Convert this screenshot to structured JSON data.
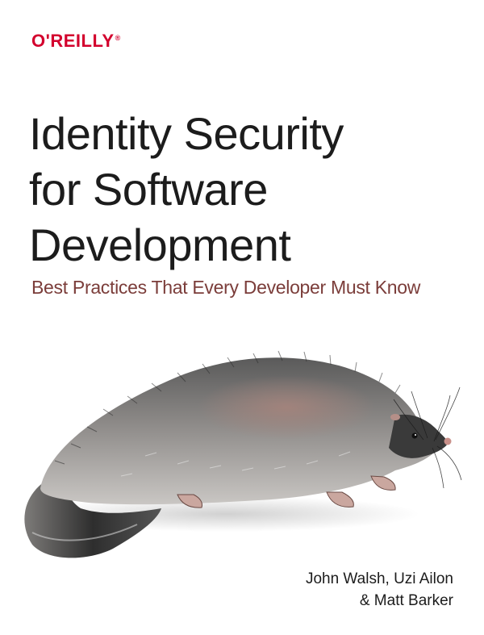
{
  "publisher": {
    "name": "O'REILLY",
    "registered_mark": "®"
  },
  "title": {
    "lines": [
      "Identity Security",
      "for Software",
      "Development"
    ]
  },
  "subtitle": "Best Practices That Every Developer Must Know",
  "authors": {
    "line1": "John Walsh, Uzi Ailon",
    "line2": "& Matt Barker"
  },
  "illustration": {
    "icon": "hedgehog-illustration-icon"
  },
  "colors": {
    "publisher_red": "#d3002d",
    "subtitle_brown": "#7b3d3a",
    "title_black": "#1c1c1c"
  }
}
